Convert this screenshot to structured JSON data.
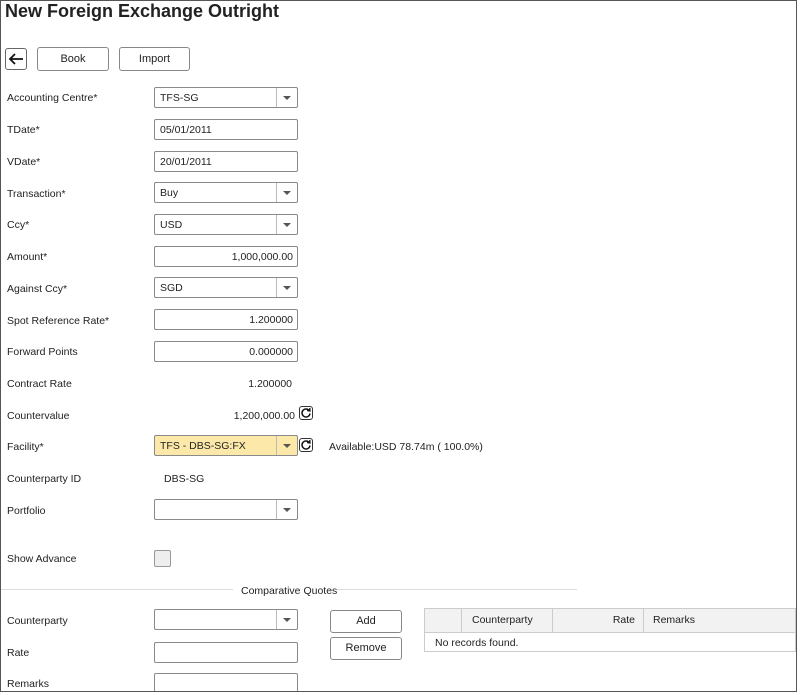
{
  "page": {
    "title": "New Foreign Exchange Outright"
  },
  "toolbar": {
    "book_label": "Book",
    "import_label": "Import"
  },
  "form": {
    "accounting_centre": {
      "label": "Accounting Centre*",
      "value": "TFS-SG"
    },
    "tdate": {
      "label": "TDate*",
      "value": "05/01/2011"
    },
    "vdate": {
      "label": "VDate*",
      "value": "20/01/2011"
    },
    "transaction": {
      "label": "Transaction*",
      "value": "Buy"
    },
    "ccy": {
      "label": "Ccy*",
      "value": "USD"
    },
    "amount": {
      "label": "Amount*",
      "value": "1,000,000.00"
    },
    "against_ccy": {
      "label": "Against Ccy*",
      "value": "SGD"
    },
    "spot_rate": {
      "label": "Spot Reference Rate*",
      "value": "1.200000"
    },
    "forward_points": {
      "label": "Forward Points",
      "value": "0.000000"
    },
    "contract_rate": {
      "label": "Contract Rate",
      "value": "1.200000"
    },
    "countervalue": {
      "label": "Countervalue",
      "value": "1,200,000.00"
    },
    "facility": {
      "label": "Facility*",
      "value": "TFS - DBS-SG:FX",
      "available": "Available:USD 78.74m ( 100.0%)"
    },
    "counterparty_id": {
      "label": "Counterparty ID",
      "value": "DBS-SG"
    },
    "portfolio": {
      "label": "Portfolio",
      "value": ""
    },
    "show_advance": {
      "label": "Show Advance"
    }
  },
  "quotes": {
    "section_title": "Comparative Quotes",
    "counterparty_label": "Counterparty",
    "rate_label": "Rate",
    "remarks_label": "Remarks",
    "add_label": "Add",
    "remove_label": "Remove",
    "columns": [
      "Counterparty",
      "Rate",
      "Remarks"
    ],
    "empty_text": "No records found."
  },
  "colors": {
    "highlight": "#fce8a8"
  },
  "icons": {
    "back": "arrow-left-icon",
    "refresh": "refresh-icon",
    "dropdown": "chevron-down-icon"
  }
}
